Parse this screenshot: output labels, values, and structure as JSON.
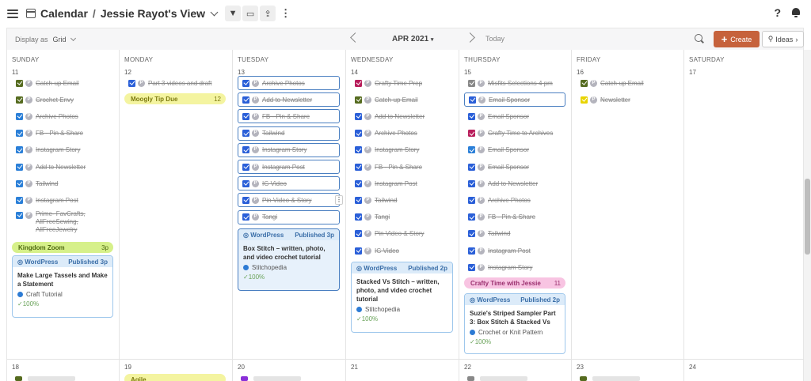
{
  "header": {
    "app": "Calendar",
    "separator": "/",
    "view": "Jessie Rayot's View",
    "help": "?"
  },
  "toolbar": {
    "display_label": "Display as",
    "display_value": "Grid",
    "month": "APR 2021",
    "month_caret": "▾",
    "today": "Today",
    "create": "Create",
    "ideas": "Ideas"
  },
  "colors": {
    "accent": "#c6623c",
    "selected": "#4a7fc1",
    "card_border": "#9ec7ec"
  },
  "days": [
    "SUNDAY",
    "MONDAY",
    "TUESDAY",
    "WEDNESDAY",
    "THURSDAY",
    "FRIDAY",
    "SATURDAY"
  ],
  "week1": [
    "11",
    "12",
    "13",
    "14",
    "15",
    "16",
    "17"
  ],
  "week2": [
    "18",
    "19",
    "20",
    "21",
    "22",
    "23",
    "24"
  ],
  "sun": {
    "tasks": [
      "Catch-up Email",
      "Crochet Envy",
      "Archive Photos",
      "FB - Pin & Share",
      "Instagram Story",
      "Add to Newsletter",
      "Tailwind",
      "Instagram Post",
      "Prime- FavCrafts, AllFreeSewing, AllFreeJewelry"
    ],
    "event": {
      "name": "Kingdom Zoom",
      "time": "3p"
    },
    "card": {
      "source": "WordPress",
      "status": "Published 3p",
      "title": "Make Large Tassels and Make a Statement",
      "category": "Craft Tutorial",
      "progress": "100%"
    }
  },
  "mon": {
    "tasks": [
      "Part 3 videos and draft"
    ],
    "event": {
      "name": "Moogly Tip Due",
      "time": "12"
    }
  },
  "tue": {
    "tasks": [
      "Archive Photos",
      "Add to Newsletter",
      "FB - Pin & Share",
      "Tailwind",
      "Instagram Story",
      "Instagram Post",
      "IG Video",
      "Pin Video & Story",
      "Tangi"
    ],
    "card": {
      "source": "WordPress",
      "status": "Published 3p",
      "title": "Box Stitch – written, photo, and video crochet tutorial",
      "category": "Stitchopedia",
      "progress": "100%"
    }
  },
  "wed": {
    "tasks": [
      "Crafty Time Prep",
      "Catch-up Email",
      "Add to Newsletter",
      "Archive Photos",
      "Instagram Story",
      "FB - Pin & Share",
      "Instagram Post",
      "Tailwind",
      "Tangi",
      "Pin Video & Story",
      "IG Video"
    ],
    "card": {
      "source": "WordPress",
      "status": "Published 2p",
      "title": "Stacked Vs Stitch – written, photo, and video crochet tutorial",
      "category": "Stitchopedia",
      "progress": "100%"
    }
  },
  "thu": {
    "tasks": [
      "Misfits Selections 4 pm",
      "Email Sponsor",
      "Email Sponsor",
      "Crafty Time to Archives",
      "Email Sponsor",
      "Email Sponsor",
      "Add to Newsletter",
      "Archive Photos",
      "FB - Pin & Share",
      "Tailwind",
      "Instagram Post",
      "Instagram Story"
    ],
    "event": {
      "name": "Crafty Time with Jessie",
      "time": "11"
    },
    "card": {
      "source": "WordPress",
      "status": "Published 2p",
      "title": "Suzie's Striped Sampler Part 3: Box Stitch & Stacked Vs",
      "category": "Crochet or Knit Pattern",
      "progress": "100%"
    }
  },
  "fri": {
    "tasks": [
      "Catch-up Email",
      "Newsletter"
    ]
  },
  "week2_stubs": {
    "mon": "Agile"
  },
  "ui": {
    "p": "P",
    "check": "✓",
    "kebab": "⋮",
    "plus": "+",
    "bulb": "♀"
  }
}
